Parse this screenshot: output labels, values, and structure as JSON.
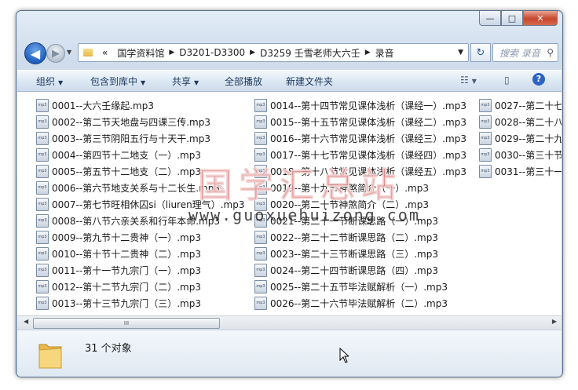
{
  "window": {
    "minimize_label": "—",
    "maximize_label": "□",
    "close_label": "✕"
  },
  "nav": {
    "back_glyph": "◀",
    "forward_glyph": "▶",
    "history_glyph": "▼",
    "breadcrumb_prefix": "«",
    "breadcrumbs": [
      "国学资料馆",
      "D3201-D3300",
      "D3259 壬雪老师大六壬",
      "录音"
    ],
    "crumb_sep": "▶",
    "dropdown_glyph": "▼",
    "refresh_glyph": "↻",
    "search_placeholder": "搜索 录音",
    "search_glyph": "⚲"
  },
  "toolbar": {
    "organize": "组织",
    "include_in_library": "包含到库中",
    "share": "共享",
    "play_all": "全部播放",
    "new_folder": "新建文件夹",
    "dropdown_glyph": "▼",
    "views_glyph": "☷",
    "preview_glyph": "▯",
    "help_glyph": "?"
  },
  "file_icon_text": "mp3",
  "files": {
    "col1": [
      "0001--大六壬缘起.mp3",
      "0002--第二节天地盘与四课三传.mp3",
      "0003--第三节阴阳五行与十天干.mp3",
      "0004--第四节十二地支（一）.mp3",
      "0005--第五节十二地支（二）.mp3",
      "0006--第六节地支关系与十二长生.mp3",
      "0007--第七节旺相休囚si（liuren理气）.mp3",
      "0008--第八节六亲关系和行年本命.mp3",
      "0009--第九节十二贵神（一）.mp3",
      "0010--第十节十二贵神（二）.mp3",
      "0011--第十一节九宗门（一）.mp3",
      "0012--第十二节九宗门（二）.mp3",
      "0013--第十三节九宗门（三）.mp3"
    ],
    "col2": [
      "0014--第十四节常见课体浅析（课经一）.mp3",
      "0015--第十五节常见课体浅析（课经二）.mp3",
      "0016--第十六节常见课体浅析（课经三）.mp3",
      "0017--第十七节常见课体浅析（课经四）.mp3",
      "0018--第十八节常见课体浅析（课经五）.mp3",
      "0019--第十九节神煞简介（一）.mp3",
      "0020--第二十节神煞简介（二）.mp3",
      "0021--第二十一节断课思路（一）.mp3",
      "0022--第二十二节断课思路（二）.mp3",
      "0023--第二十三节断课思路（三）.mp3",
      "0024--第二十四节断课思路（四）.mp3",
      "0025--第二十五节毕法赋解析（一）.mp3",
      "0026--第二十六节毕法赋解析（二）.mp3"
    ],
    "col3": [
      "0027--第二十七",
      "0028--第二十八",
      "0029--第二十九",
      "0030--第三十节",
      "0031--第三十一"
    ]
  },
  "watermark": {
    "chinese": "国学汇总站",
    "url": "www.guoxuehuizong.com"
  },
  "scrollbar": {
    "left_glyph": "◀",
    "right_glyph": "▶",
    "grip": "III"
  },
  "details": {
    "item_count": "31 个对象"
  }
}
